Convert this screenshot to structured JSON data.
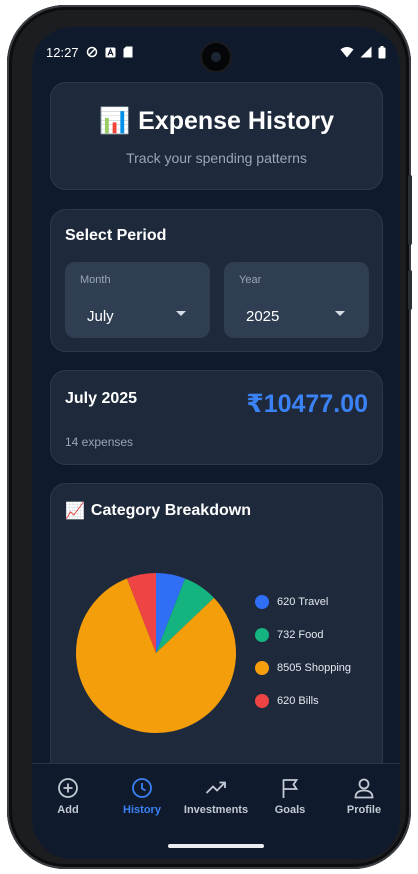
{
  "status_bar": {
    "time": "12:27"
  },
  "header": {
    "emoji": "📊",
    "title": "Expense History",
    "subtitle": "Track your spending patterns"
  },
  "period": {
    "title": "Select Period",
    "month_label": "Month",
    "month_value": "July",
    "year_label": "Year",
    "year_value": "2025"
  },
  "summary": {
    "title": "July 2025",
    "amount": "₹10477.00",
    "count": "14 expenses"
  },
  "breakdown": {
    "emoji": "📈",
    "title": "Category Breakdown",
    "legend": [
      {
        "label": "620 Travel",
        "color": "#2f6ef5"
      },
      {
        "label": "732 Food",
        "color": "#15b37f"
      },
      {
        "label": "8505 Shopping",
        "color": "#f59e0b"
      },
      {
        "label": "620 Bills",
        "color": "#ef4444"
      }
    ]
  },
  "chart_data": {
    "type": "pie",
    "categories": [
      "Travel",
      "Food",
      "Shopping",
      "Bills"
    ],
    "values": [
      620,
      732,
      8505,
      620
    ],
    "colors": [
      "#2f6ef5",
      "#15b37f",
      "#f59e0b",
      "#ef4444"
    ]
  },
  "nav": {
    "items": [
      {
        "label": "Add",
        "icon": "add-circle-icon",
        "active": false
      },
      {
        "label": "History",
        "icon": "clock-icon",
        "active": true
      },
      {
        "label": "Investments",
        "icon": "trending-up-icon",
        "active": false
      },
      {
        "label": "Goals",
        "icon": "flag-icon",
        "active": false
      },
      {
        "label": "Profile",
        "icon": "user-icon",
        "active": false
      }
    ]
  }
}
